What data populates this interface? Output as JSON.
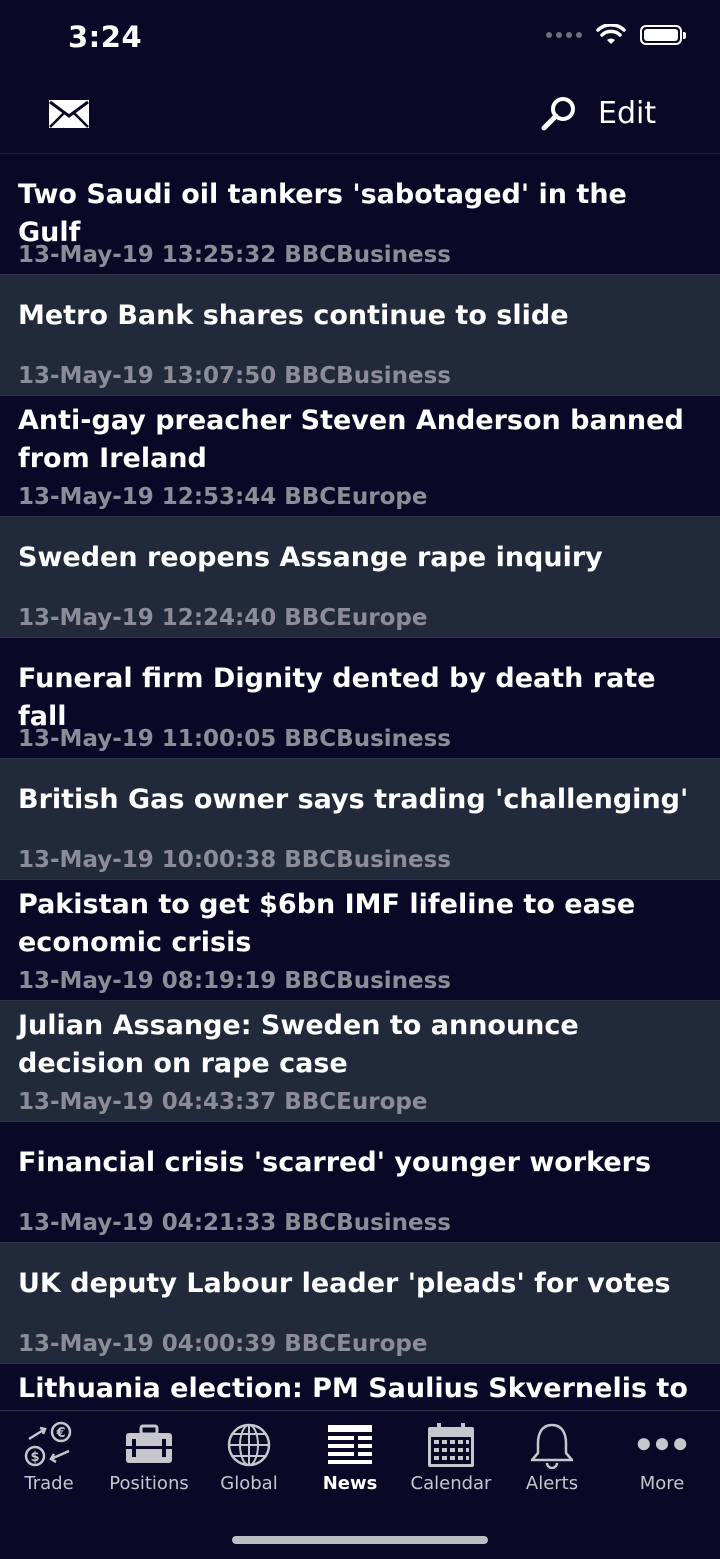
{
  "status": {
    "time": "3:24"
  },
  "header": {
    "edit_label": "Edit"
  },
  "news": [
    {
      "title": "Two Saudi oil tankers 'sabotaged' in the Gulf",
      "meta": "13-May-19 13:25:32 BBCBusiness"
    },
    {
      "title": "Metro Bank shares continue to slide",
      "meta": "13-May-19 13:07:50 BBCBusiness"
    },
    {
      "title": "Anti-gay preacher Steven Anderson banned from Ireland",
      "meta": "13-May-19 12:53:44 BBCEurope"
    },
    {
      "title": "Sweden reopens Assange rape inquiry",
      "meta": "13-May-19 12:24:40 BBCEurope"
    },
    {
      "title": "Funeral firm Dignity dented by death rate fall",
      "meta": "13-May-19 11:00:05 BBCBusiness"
    },
    {
      "title": "British Gas owner says trading 'challenging'",
      "meta": "13-May-19 10:00:38 BBCBusiness"
    },
    {
      "title": "Pakistan to get $6bn IMF lifeline to ease economic crisis",
      "meta": "13-May-19 08:19:19 BBCBusiness"
    },
    {
      "title": "Julian Assange: Sweden to announce decision on rape case",
      "meta": "13-May-19 04:43:37 BBCEurope"
    },
    {
      "title": "Financial crisis 'scarred' younger workers",
      "meta": "13-May-19 04:21:33 BBCBusiness"
    },
    {
      "title": "UK deputy Labour leader 'pleads' for votes",
      "meta": "13-May-19 04:00:39 BBCEurope"
    },
    {
      "title": "Lithuania election: PM Saulius Skvernelis to quit",
      "meta": ""
    }
  ],
  "tabs": [
    {
      "label": "Trade",
      "icon": "trade-currency-icon"
    },
    {
      "label": "Positions",
      "icon": "briefcase-icon"
    },
    {
      "label": "Global",
      "icon": "globe-icon"
    },
    {
      "label": "News",
      "icon": "newspaper-icon",
      "active": true
    },
    {
      "label": "Calendar",
      "icon": "calendar-icon"
    },
    {
      "label": "Alerts",
      "icon": "bell-icon"
    },
    {
      "label": "More",
      "icon": "more-dots-icon"
    }
  ],
  "colors": {
    "background": "#0a0827",
    "row_alt": "#212a3b",
    "meta_text": "#8c8c97",
    "tab_inactive": "#c6c6cc"
  }
}
